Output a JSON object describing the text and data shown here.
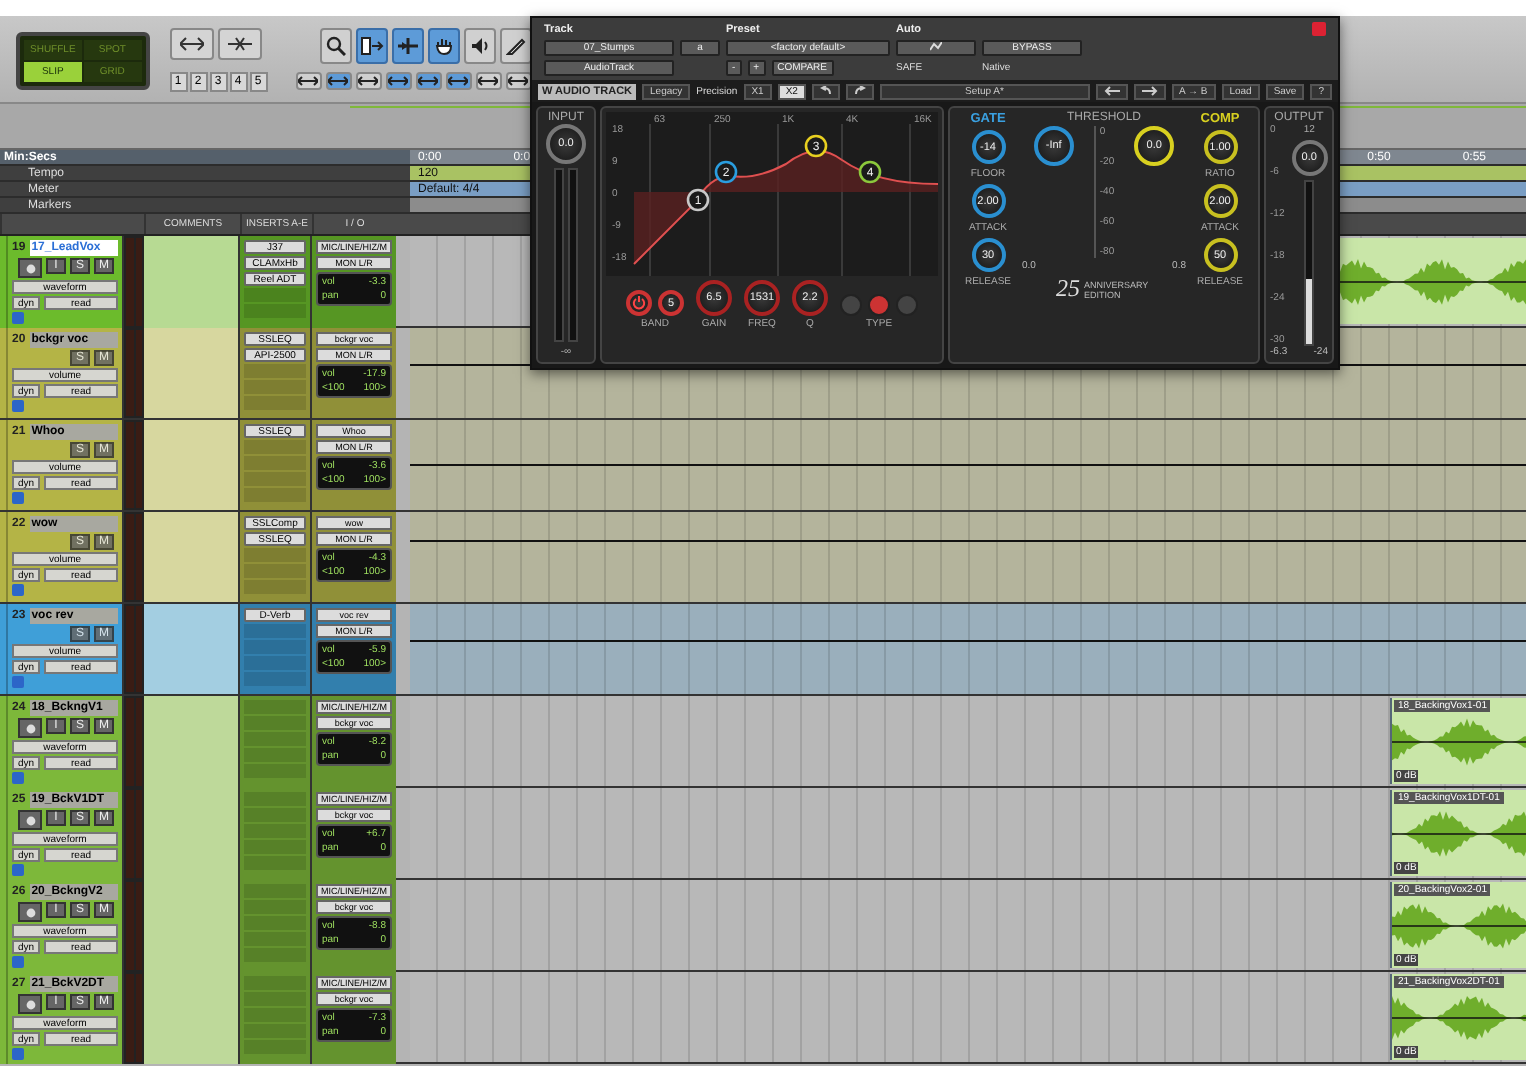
{
  "toolbar": {
    "edit_modes": [
      {
        "label": "SHUFFLE",
        "selected": false
      },
      {
        "label": "SPOT",
        "selected": false
      },
      {
        "label": "SLIP",
        "selected": true
      },
      {
        "label": "GRID",
        "selected": false
      }
    ],
    "zoom_presets": [
      "1",
      "2",
      "3",
      "4",
      "5"
    ],
    "tools": [
      {
        "kind": "zoom",
        "selected": false
      },
      {
        "kind": "trim",
        "selected": true
      },
      {
        "kind": "selector",
        "selected": true
      },
      {
        "kind": "grabber",
        "selected": true
      },
      {
        "kind": "scrub",
        "selected": false
      },
      {
        "kind": "pencil",
        "selected": false
      }
    ],
    "toggles": [
      {
        "selected": false
      },
      {
        "selected": true
      },
      {
        "selected": false
      },
      {
        "selected": true
      },
      {
        "selected": true
      },
      {
        "selected": true
      },
      {
        "selected": false
      },
      {
        "selected": false
      }
    ]
  },
  "rulers": {
    "rows": [
      {
        "label": "Min:Secs"
      },
      {
        "label": "Tempo"
      },
      {
        "label": "Meter"
      },
      {
        "label": "Markers"
      }
    ],
    "time_start": [
      "0:00",
      "0:0"
    ],
    "time_end": [
      "0:50",
      "0:55"
    ],
    "tempo": "120",
    "meter": "Default: 4/4"
  },
  "columns": [
    "COMMENTS",
    "INSERTS A-E",
    "I / O"
  ],
  "tracks": [
    {
      "number": "19",
      "name": "17_LeadVox",
      "selected": true,
      "kind": "audio",
      "color": "#6cbb2c",
      "buttons": [
        "I",
        "S",
        "M"
      ],
      "view": "waveform",
      "dyn": "dyn",
      "mode": "read",
      "inserts": [
        "J37",
        "CLAMxHb",
        "Reel ADT"
      ],
      "io": [
        "MIC/LINE/HIZ/M",
        "MON L/R"
      ],
      "vol": [
        "vol",
        "-3.3"
      ],
      "pan": [
        "pan",
        "0"
      ],
      "clip": {
        "kind": "unlabeled"
      }
    },
    {
      "number": "20",
      "name": "bckgr voc",
      "selected": false,
      "kind": "aux",
      "color": "#b4b446",
      "buttons": [
        "S",
        "M"
      ],
      "view": "volume",
      "dyn": "dyn",
      "mode": "read",
      "inserts": [
        "SSLEQ",
        "API-2500"
      ],
      "io": [
        "bckgr voc",
        "MON L/R"
      ],
      "vol": [
        "vol",
        "-17.9"
      ],
      "pan": [
        "<100",
        "100>"
      ]
    },
    {
      "number": "21",
      "name": "Whoo",
      "selected": false,
      "kind": "aux",
      "color": "#b4b446",
      "buttons": [
        "S",
        "M"
      ],
      "view": "volume",
      "dyn": "dyn",
      "mode": "read",
      "inserts": [
        "SSLEQ"
      ],
      "io": [
        "Whoo",
        "MON L/R"
      ],
      "vol": [
        "vol",
        "-3.6"
      ],
      "pan": [
        "<100",
        "100>"
      ]
    },
    {
      "number": "22",
      "name": "wow",
      "selected": false,
      "kind": "aux",
      "color": "#b4b446",
      "buttons": [
        "S",
        "M"
      ],
      "view": "volume",
      "dyn": "dyn",
      "mode": "read",
      "inserts": [
        "SSLComp",
        "SSLEQ"
      ],
      "io": [
        "wow",
        "MON L/R"
      ],
      "vol": [
        "vol",
        "-4.3"
      ],
      "pan": [
        "<100",
        "100>"
      ]
    },
    {
      "number": "23",
      "name": "voc rev",
      "selected": false,
      "kind": "aux",
      "color": "#3f9fd8",
      "buttons": [
        "S",
        "M"
      ],
      "view": "volume",
      "dyn": "dyn",
      "mode": "read",
      "inserts": [
        "D-Verb"
      ],
      "io": [
        "voc rev",
        "MON L/R"
      ],
      "vol": [
        "vol",
        "-5.9"
      ],
      "pan": [
        "<100",
        "100>"
      ]
    },
    {
      "number": "24",
      "name": "18_BckngV1",
      "selected": false,
      "kind": "audio",
      "color": "#7db83a",
      "buttons": [
        "I",
        "S",
        "M"
      ],
      "view": "waveform",
      "dyn": "dyn",
      "mode": "read",
      "io": [
        "MIC/LINE/HIZ/M",
        "bckgr voc"
      ],
      "vol": [
        "vol",
        "-8.2"
      ],
      "pan": [
        "pan",
        "0"
      ],
      "clip": {
        "kind": "labeled",
        "label": "18_BackingVox1-01",
        "gain": "0 dB"
      }
    },
    {
      "number": "25",
      "name": "19_BckV1DT",
      "selected": false,
      "kind": "audio",
      "color": "#7db83a",
      "buttons": [
        "I",
        "S",
        "M"
      ],
      "view": "waveform",
      "dyn": "dyn",
      "mode": "read",
      "io": [
        "MIC/LINE/HIZ/M",
        "bckgr voc"
      ],
      "vol": [
        "vol",
        "+6.7"
      ],
      "pan": [
        "pan",
        "0"
      ],
      "clip": {
        "kind": "labeled",
        "label": "19_BackingVox1DT-01",
        "gain": "0 dB"
      }
    },
    {
      "number": "26",
      "name": "20_BckngV2",
      "selected": false,
      "kind": "audio",
      "color": "#7db83a",
      "buttons": [
        "I",
        "S",
        "M"
      ],
      "view": "waveform",
      "dyn": "dyn",
      "mode": "read",
      "io": [
        "MIC/LINE/HIZ/M",
        "bckgr voc"
      ],
      "vol": [
        "vol",
        "-8.8"
      ],
      "pan": [
        "pan",
        "0"
      ],
      "clip": {
        "kind": "labeled",
        "label": "20_BackingVox2-01",
        "gain": "0 dB"
      }
    },
    {
      "number": "27",
      "name": "21_BckV2DT",
      "selected": false,
      "kind": "audio",
      "color": "#7db83a",
      "buttons": [
        "I",
        "S",
        "M"
      ],
      "view": "waveform",
      "dyn": "dyn",
      "mode": "read",
      "io": [
        "MIC/LINE/HIZ/M",
        "bckgr voc"
      ],
      "vol": [
        "vol",
        "-7.3"
      ],
      "pan": [
        "pan",
        "0"
      ],
      "clip": {
        "kind": "labeled",
        "label": "21_BackingVox2DT-01",
        "gain": "0 dB"
      }
    }
  ],
  "plugin": {
    "labels": [
      "Track",
      "Preset",
      "Auto"
    ],
    "track_name": "07_Stumps",
    "track_chip": "a",
    "preset": "<factory default>",
    "track_type": "AudioTrack",
    "minus": "-",
    "plus": "+",
    "compare": "COMPARE",
    "bypass": "BYPASS",
    "safe": "SAFE",
    "native": "Native",
    "brand": "W AUDIO TRACK",
    "legacy": "Legacy",
    "precision": "Precision",
    "oversampling": [
      {
        "label": "X1",
        "selected": false
      },
      {
        "label": "X2",
        "selected": true
      }
    ],
    "setup": "Setup A*",
    "ab": "A → B",
    "load": "Load",
    "save": "Save",
    "help": "?",
    "input": {
      "title": "INPUT",
      "value": "0.0",
      "floor": "-∞"
    },
    "eq": {
      "freq_labels": [
        "63",
        "250",
        "1K",
        "4K",
        "16K"
      ],
      "db_labels": [
        "18",
        "9",
        "0",
        "-9",
        "-18"
      ],
      "bands": [
        {
          "label": "1",
          "color": "#c8c8c8"
        },
        {
          "label": "2",
          "color": "#2a9ee0"
        },
        {
          "label": "3",
          "color": "#e8d020"
        },
        {
          "label": "4",
          "color": "#8cc83c"
        }
      ],
      "power_on": true,
      "band_value": "5",
      "knobs": [
        {
          "label": "GAIN",
          "value": "6.5"
        },
        {
          "label": "FREQ",
          "value": "1531"
        },
        {
          "label": "Q",
          "value": "2.2"
        }
      ],
      "types": [
        {
          "selected": false
        },
        {
          "selected": true
        },
        {
          "selected": false
        }
      ],
      "band_label": "BAND",
      "type_label": "TYPE"
    },
    "dynamics": {
      "gate_title": "GATE",
      "threshold_title": "THRESHOLD",
      "comp_title": "COMP",
      "gate_knobs": [
        {
          "label": "FLOOR",
          "value": "-14"
        },
        {
          "label": "ATTACK",
          "value": "2.00"
        },
        {
          "label": "RELEASE",
          "value": "30"
        }
      ],
      "comp_knobs": [
        {
          "label": "RATIO",
          "value": "1.00"
        },
        {
          "label": "ATTACK",
          "value": "2.00"
        },
        {
          "label": "RELEASE",
          "value": "50"
        }
      ],
      "gate_threshold": "-Inf",
      "comp_threshold": "0.0",
      "scale": [
        "0",
        "-20",
        "-40",
        "-60",
        "-80"
      ],
      "gate_reading": "0.0",
      "comp_reading": "0.8",
      "logo_number": "25",
      "logo_text": "ANNIVERSARY EDITION"
    },
    "output": {
      "title": "OUTPUT",
      "value": "0.0",
      "top_label": "12",
      "scale": [
        "0",
        "-6",
        "-12",
        "-18",
        "-24",
        "-30"
      ],
      "reading": "-6.3",
      "floor": "-24"
    }
  }
}
